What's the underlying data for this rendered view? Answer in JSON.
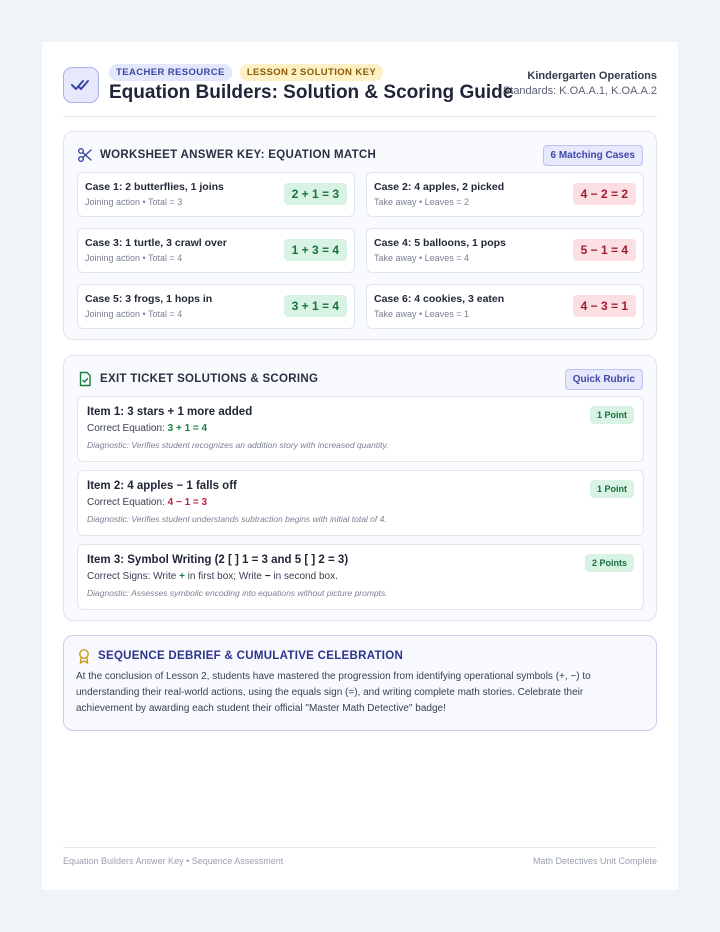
{
  "header": {
    "badge_resource": "TEACHER RESOURCE",
    "badge_lesson": "LESSON 2 SOLUTION KEY",
    "title": "Equation Builders: Solution & Scoring Guide",
    "grade": "Kindergarten Operations",
    "standards": "Standards: K.OA.A.1, K.OA.A.2"
  },
  "answer_key": {
    "heading": "WORKSHEET ANSWER KEY: EQUATION MATCH",
    "count_label": "6 Matching Cases",
    "cases": [
      {
        "title": "Case 1: 2 butterflies, 1 joins",
        "sub": "Joining action • Total = 3",
        "equation": "2 + 1 = 3"
      },
      {
        "title": "Case 2: 4 apples, 2 picked",
        "sub": "Take away • Leaves = 2",
        "equation": "4 − 2 = 2"
      },
      {
        "title": "Case 3: 1 turtle, 3 crawl over",
        "sub": "Joining action • Total = 4",
        "equation": "1 + 3 = 4"
      },
      {
        "title": "Case 4: 5 balloons, 1 pops",
        "sub": "Take away • Leaves = 4",
        "equation": "5 − 1 = 4"
      },
      {
        "title": "Case 5: 3 frogs, 1 hops in",
        "sub": "Joining action • Total = 4",
        "equation": "3 + 1 = 4"
      },
      {
        "title": "Case 6: 4 cookies, 3 eaten",
        "sub": "Take away • Leaves = 1",
        "equation": "4 − 3 = 1"
      }
    ]
  },
  "exit_ticket": {
    "heading": "EXIT TICKET SOLUTIONS & SCORING",
    "rubric_label": "Quick Rubric",
    "items": [
      {
        "title": "Item 1: 3 stars + 1 more added",
        "correct_prefix": "Correct Equation: ",
        "correct_value": "3 + 1 = 4",
        "diagnostic": "Diagnostic: Verifies student recognizes an addition story with increased quantity.",
        "points": "1 Point"
      },
      {
        "title": "Item 2: 4 apples − 1 falls off",
        "correct_prefix": "Correct Equation: ",
        "correct_value": "4 − 1 = 3",
        "diagnostic": "Diagnostic: Verifies student understands subtraction begins with initial total of 4.",
        "points": "1 Point"
      },
      {
        "title": "Item 3: Symbol Writing (2 [ ] 1 = 3 and 5 [ ] 2 = 3)",
        "correct_a": "Correct Signs: Write ",
        "sign_plus": "+",
        "correct_b": " in first box; Write ",
        "sign_minus": "−",
        "correct_c": " in second box.",
        "diagnostic": "Diagnostic: Assesses symbolic encoding into equations without picture prompts.",
        "points": "2 Points"
      }
    ]
  },
  "debrief": {
    "heading": "SEQUENCE DEBRIEF & CUMULATIVE CELEBRATION",
    "text": "At the conclusion of Lesson 2, students have mastered the progression from identifying operational symbols (+, −) to understanding their real-world actions, using the equals sign (=), and writing complete math stories. Celebrate their achievement by awarding each student their official \"Master Math Detective\" badge!"
  },
  "footer": {
    "left": "Equation Builders Answer Key • Sequence Assessment",
    "right": "Math Detectives Unit Complete"
  },
  "colors": {
    "accent": "#3b46a6",
    "add_green": "#17703f",
    "sub_red": "#a01c35"
  }
}
